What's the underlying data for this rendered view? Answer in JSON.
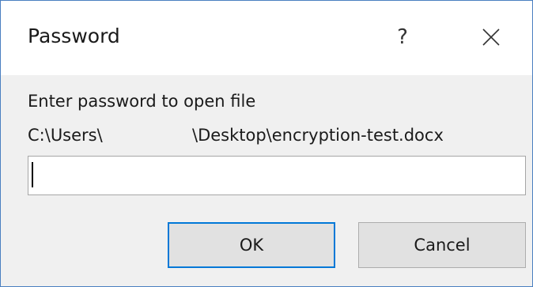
{
  "dialog": {
    "title": "Password",
    "help_label": "?",
    "close_icon": "close-icon",
    "prompt": "Enter password to open file",
    "path_part1": "C:\\Users\\",
    "path_part2": "\\Desktop\\encryption-test.docx",
    "password_value": "",
    "ok_label": "OK",
    "cancel_label": "Cancel"
  },
  "colors": {
    "accent": "#0078d7",
    "window_border": "#4a7fc1",
    "dialog_bg": "#f0f0f0",
    "button_bg": "#e1e1e1"
  }
}
